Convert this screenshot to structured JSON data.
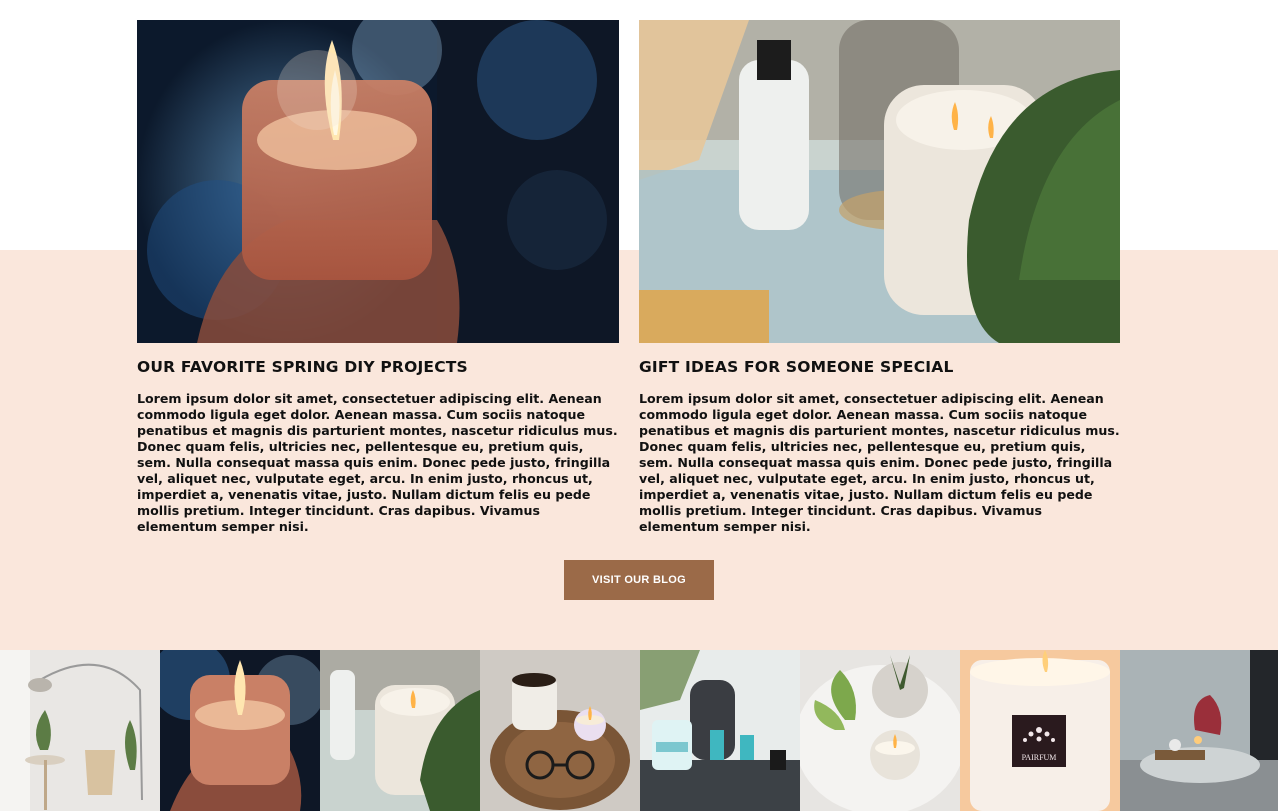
{
  "posts": [
    {
      "title": "OUR FAVORITE SPRING DIY PROJECTS",
      "body": "Lorem ipsum dolor sit amet, consectetuer adipiscing elit. Aenean commodo ligula eget dolor. Aenean massa. Cum sociis natoque penatibus et magnis dis parturient montes, nascetur ridiculus mus. Donec quam felis, ultricies nec, pellentesque eu, pretium quis, sem. Nulla consequat massa quis enim. Donec pede justo, fringilla vel, aliquet nec, vulputate eget, arcu. In enim justo, rhoncus ut, imperdiet a, venenatis vitae, justo. Nullam dictum felis eu pede mollis pretium. Integer tincidunt. Cras dapibus. Vivamus elementum semper nisi."
    },
    {
      "title": "GIFT IDEAS FOR SOMEONE SPECIAL",
      "body": "Lorem ipsum dolor sit amet, consectetuer adipiscing elit. Aenean commodo ligula eget dolor. Aenean massa. Cum sociis natoque penatibus et magnis dis parturient montes, nascetur ridiculus mus. Donec quam felis, ultricies nec, pellentesque eu, pretium quis, sem. Nulla consequat massa quis enim. Donec pede justo, fringilla vel, aliquet nec, vulputate eget, arcu. In enim justo, rhoncus ut, imperdiet a, venenatis vitae, justo. Nullam dictum felis eu pede mollis pretium. Integer tincidunt. Cras dapibus. Vivamus elementum semper nisi."
    }
  ],
  "blog_button": {
    "label": "VISIT OUR BLOG"
  },
  "gallery": {
    "brand_label": "PAIRFUM"
  },
  "colors": {
    "section_background": "#fae7dc",
    "button_background": "#9b6a48",
    "button_text": "#ffffff"
  }
}
